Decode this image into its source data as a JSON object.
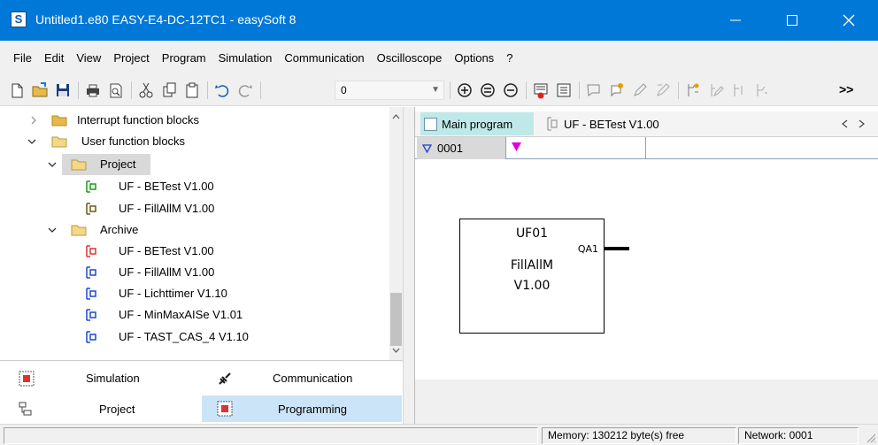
{
  "window": {
    "title": "Untitled1.e80 EASY-E4-DC-12TC1 - easySoft 8",
    "app_icon": "S"
  },
  "menu": [
    "File",
    "Edit",
    "View",
    "Project",
    "Program",
    "Simulation",
    "Communication",
    "Oscilloscope",
    "Options",
    "?"
  ],
  "toolbar": {
    "combo_value": "0",
    "more_label": ">>"
  },
  "tree": {
    "rows": [
      {
        "label": "Interrupt function blocks",
        "icon": "folder-icon"
      },
      {
        "label": "User function blocks",
        "icon": "folder-open-icon"
      },
      {
        "label": "Project",
        "icon": "folder-open-icon"
      },
      {
        "label": "UF - BETest V1.00",
        "icon": "uf-green-icon"
      },
      {
        "label": "UF - FillAllM V1.00",
        "icon": "uf-olive-icon"
      },
      {
        "label": "Archive",
        "icon": "folder-open-icon"
      },
      {
        "label": "UF - BETest V1.00",
        "icon": "uf-red-icon"
      },
      {
        "label": "UF - FillAllM V1.00",
        "icon": "uf-blue-icon"
      },
      {
        "label": "UF - Lichttimer V1.10",
        "icon": "uf-blue-icon"
      },
      {
        "label": "UF - MinMaxAISe V1.01",
        "icon": "uf-blue-icon"
      },
      {
        "label": "UF - TAST_CAS_4 V1.10",
        "icon": "uf-blue-icon"
      }
    ]
  },
  "nav": {
    "simulation": "Simulation",
    "communication": "Communication",
    "project": "Project",
    "programming": "Programming"
  },
  "editor": {
    "tabs": [
      "Main program",
      "UF - BETest V1.00"
    ],
    "network_number": "0001",
    "block": {
      "name": "UF01",
      "output": "QA1",
      "type": "FillAllM",
      "version": "V1.00"
    }
  },
  "status": {
    "memory": "Memory: 130212 byte(s) free",
    "network": "Network: 0001"
  },
  "colors": {
    "titlebar": "#0078d7",
    "active_tab": "#bfe9e8",
    "active_nav": "#cce4f7",
    "network_marker": "#e000e0"
  }
}
